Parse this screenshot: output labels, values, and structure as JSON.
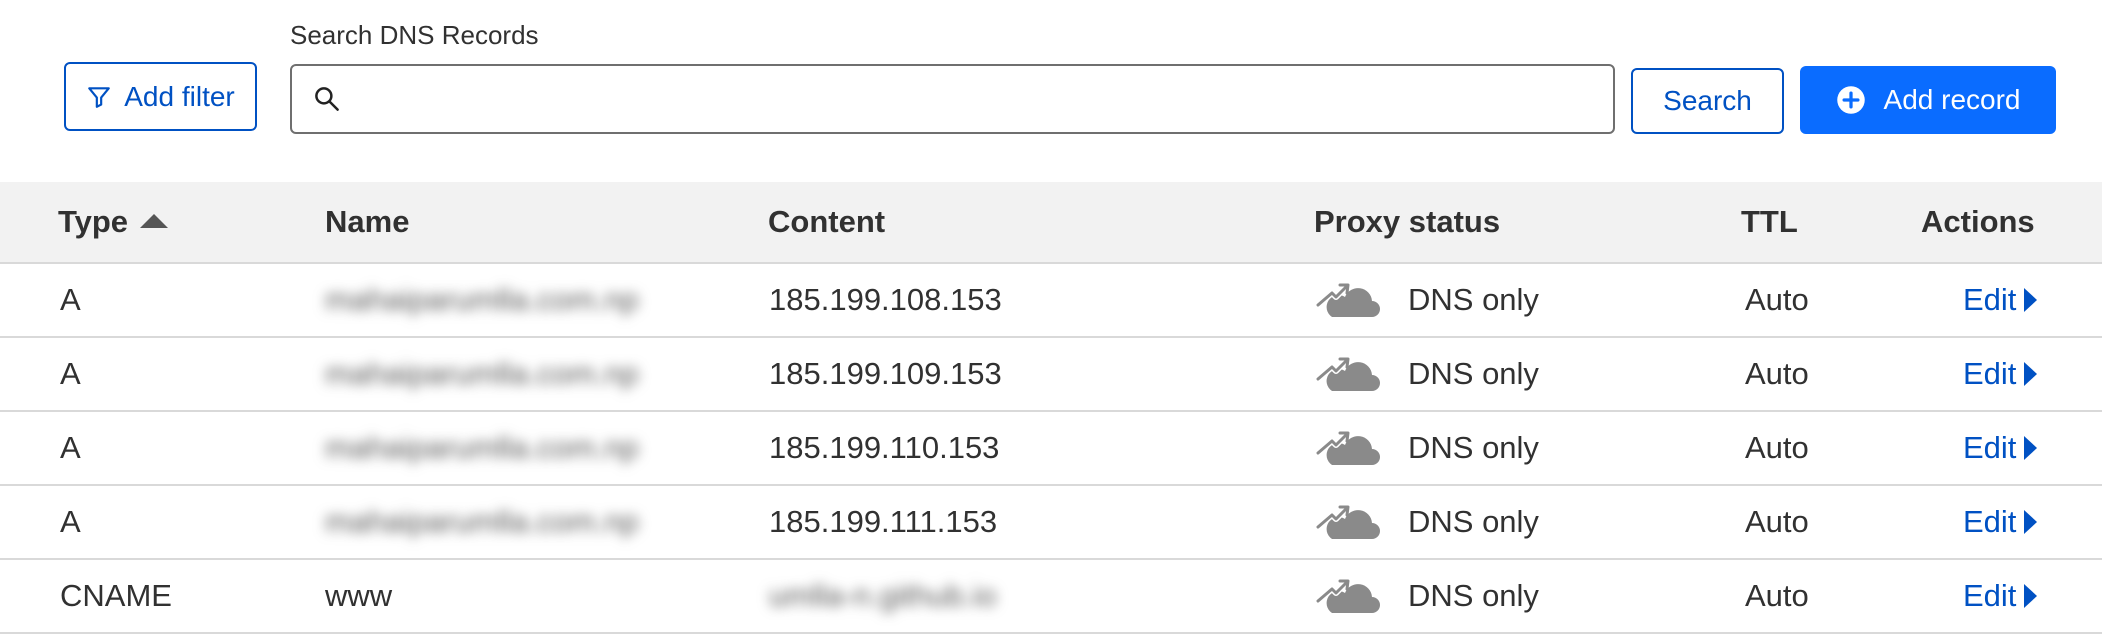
{
  "toolbar": {
    "add_filter_label": "Add filter",
    "search_label": "Search DNS Records",
    "search_value": "",
    "search_button_label": "Search",
    "add_record_label": "Add record",
    "icons": {
      "filter": "filter-icon",
      "search": "search-icon",
      "add": "plus-circle-icon"
    }
  },
  "table": {
    "headers": {
      "type": "Type",
      "name": "Name",
      "content": "Content",
      "proxy_status": "Proxy status",
      "ttl": "TTL",
      "actions": "Actions"
    },
    "sort": {
      "column": "Type",
      "direction": "ascending"
    },
    "rows": [
      {
        "type": "A",
        "name": "mahaiparumlla.com.np",
        "name_blurred": true,
        "content": "185.199.108.153",
        "content_blurred": false,
        "proxy_status": "DNS only",
        "ttl": "Auto",
        "action": "Edit"
      },
      {
        "type": "A",
        "name": "mahaiparumlla.com.np",
        "name_blurred": true,
        "content": "185.199.109.153",
        "content_blurred": false,
        "proxy_status": "DNS only",
        "ttl": "Auto",
        "action": "Edit"
      },
      {
        "type": "A",
        "name": "mahaiparumlla.com.np",
        "name_blurred": true,
        "content": "185.199.110.153",
        "content_blurred": false,
        "proxy_status": "DNS only",
        "ttl": "Auto",
        "action": "Edit"
      },
      {
        "type": "A",
        "name": "mahaiparumlla.com.np",
        "name_blurred": true,
        "content": "185.199.111.153",
        "content_blurred": false,
        "proxy_status": "DNS only",
        "ttl": "Auto",
        "action": "Edit"
      },
      {
        "type": "CNAME",
        "name": "www",
        "name_blurred": false,
        "content": "umlla-n.github.io",
        "content_blurred": true,
        "proxy_status": "DNS only",
        "ttl": "Auto",
        "action": "Edit"
      }
    ]
  },
  "colors": {
    "accent": "#0051c3",
    "primary_button": "#0a6cff",
    "header_bg": "#f2f2f2",
    "text": "#313131",
    "proxy_icon_gray": "#8a8a8a"
  }
}
